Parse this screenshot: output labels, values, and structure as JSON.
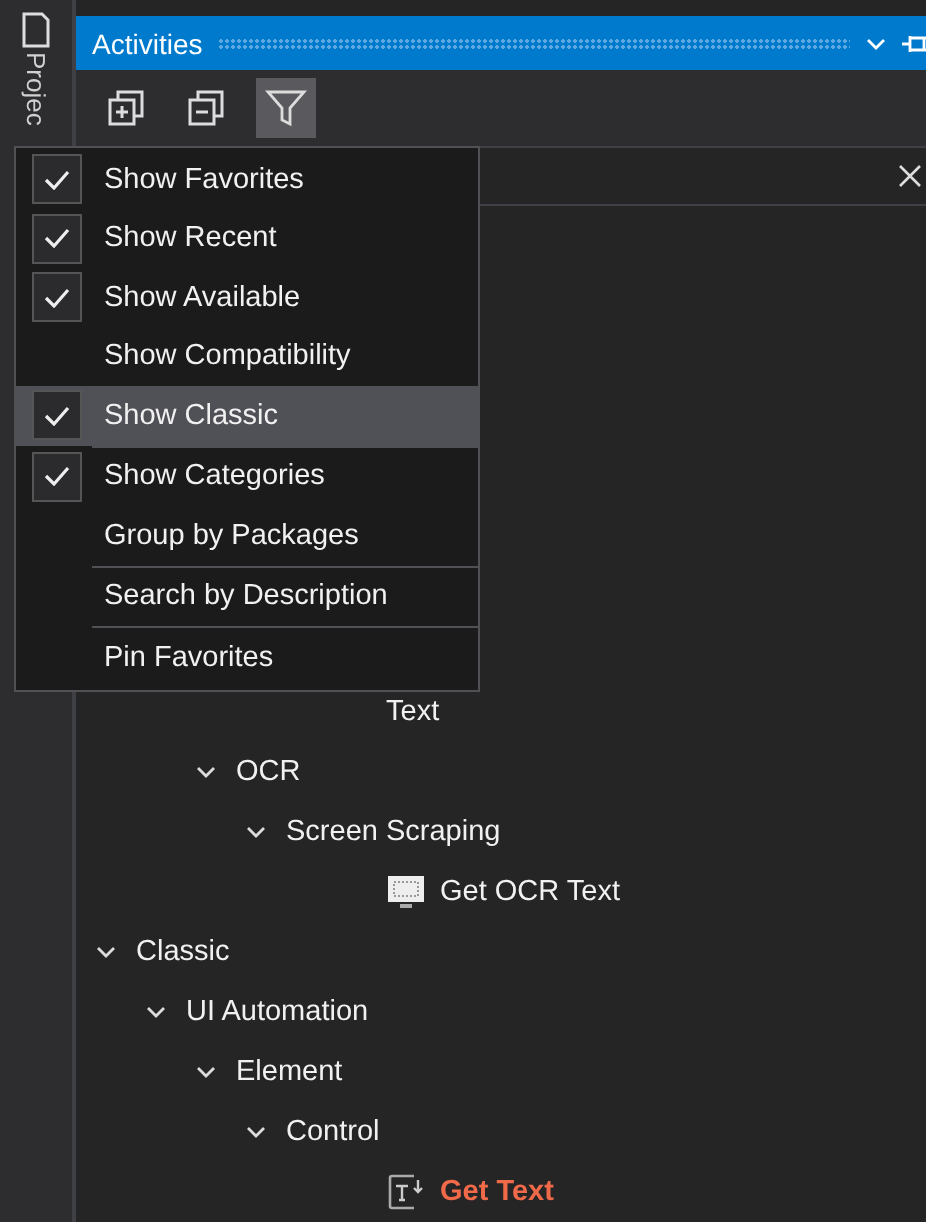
{
  "side_tab": {
    "label": "Projec"
  },
  "panel": {
    "title": "Activities"
  },
  "toolbar": [
    {
      "kind": "expand",
      "selected": false
    },
    {
      "kind": "collapse",
      "selected": false
    },
    {
      "kind": "filter",
      "selected": true
    }
  ],
  "tree": [
    {
      "children": [
        {
          "children": [
            {
              "children": [
                {
                  "children": [
                    {
                      "label": "Text"
                    }
                  ]
                }
              ]
            },
            {
              "label": "OCR",
              "expanded": true,
              "children": [
                {
                  "label": "Screen Scraping",
                  "expanded": true,
                  "children": [
                    {
                      "label": "Get OCR Text",
                      "kind": "screen"
                    }
                  ]
                }
              ]
            }
          ]
        }
      ]
    },
    {
      "label": "Classic",
      "expanded": true,
      "children": [
        {
          "label": "UI Automation",
          "expanded": true,
          "children": [
            {
              "label": "Element",
              "expanded": true,
              "children": [
                {
                  "label": "Control",
                  "expanded": true,
                  "children": [
                    {
                      "label": "Get Text",
                      "kind": "text",
                      "selected": true
                    }
                  ]
                }
              ]
            }
          ]
        }
      ]
    }
  ],
  "menu": [
    {
      "kind": "check",
      "label": "Show Favorites",
      "checked": true,
      "highlighted": false
    },
    {
      "kind": "check",
      "label": "Show Recent",
      "checked": true,
      "highlighted": false
    },
    {
      "kind": "check",
      "label": "Show Available",
      "checked": true,
      "highlighted": false
    },
    {
      "kind": "check",
      "label": "Show Compatibility",
      "checked": false,
      "highlighted": false
    },
    {
      "kind": "check",
      "label": "Show Classic",
      "checked": true,
      "highlighted": true
    },
    {
      "kind": "separator"
    },
    {
      "kind": "check",
      "label": "Show Categories",
      "checked": true,
      "highlighted": false
    },
    {
      "kind": "check",
      "label": "Group by Packages",
      "checked": false,
      "highlighted": false
    },
    {
      "kind": "separator"
    },
    {
      "kind": "check",
      "label": "Search by Description",
      "checked": false,
      "highlighted": false
    },
    {
      "kind": "separator"
    },
    {
      "kind": "check",
      "label": "Pin Favorites",
      "checked": false,
      "highlighted": false
    }
  ]
}
